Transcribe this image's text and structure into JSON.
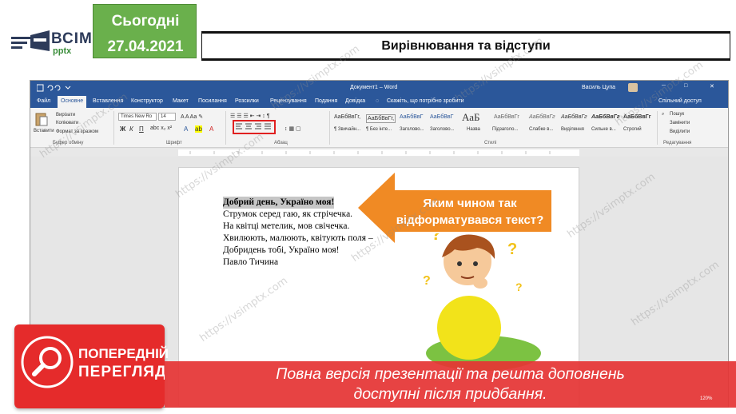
{
  "header": {
    "logo_text": "ВСІМ",
    "logo_sub": "pptx",
    "date_line1": "Сьогодні",
    "date_line2": "27.04.2021",
    "slide_title": "Вирівнювання та відступи"
  },
  "word": {
    "doc_title": "Документ1 – Word",
    "user": "Василь Цупа",
    "tabs": [
      "Файл",
      "Основне",
      "Вставлення",
      "Конструктор",
      "Макет",
      "Посилання",
      "Розсилки",
      "Рецензування",
      "Подання",
      "Довідка"
    ],
    "active_tab": "Основне",
    "tell_me": "Скажіть, що потрібно зробити",
    "share": "Спільний доступ",
    "ribbon": {
      "paste": "Вставити",
      "cut": "Вирізати",
      "copy": "Копіювати",
      "format_painter": "Формат за зразком",
      "font_name": "Times New Ro",
      "font_size": "14",
      "group_clipboard": "Буфер обміну",
      "group_font": "Шрифт",
      "group_paragraph": "Абзац",
      "group_styles": "Стилі",
      "group_editing": "Редагування",
      "find": "Пошук",
      "replace": "Замінити",
      "select": "Виділити",
      "styles": [
        {
          "preview": "АаБбВвГг,",
          "name": "¶ Звичайн..."
        },
        {
          "preview": "АаБбВвГг,",
          "name": "¶ Без інте..."
        },
        {
          "preview": "АаБбВвГ",
          "name": "Заголово..."
        },
        {
          "preview": "АаБбВвГ",
          "name": "Заголово..."
        },
        {
          "preview": "АаБ",
          "name": "Назва"
        },
        {
          "preview": "АаБ",
          "name": "Назва"
        },
        {
          "preview": "АаБбВвГг",
          "name": "Підзаголо..."
        },
        {
          "preview": "АаБбВвГг",
          "name": "Слабке в..."
        },
        {
          "preview": "АаБбВвГг",
          "name": "Виділення"
        },
        {
          "preview": "АаБбВвГг",
          "name": "Сильне в..."
        },
        {
          "preview": "АаБбВвГг",
          "name": "Строгий"
        }
      ]
    },
    "poem": [
      "Добрий день, Україно моя!",
      "Струмок серед гаю, як стрічечка.",
      "На квітці метелик, мов свічечка.",
      "Хвилюють, малюють, квітують поля –",
      "Добридень тобі, Україно моя!",
      "Павло Тичина"
    ],
    "zoom": "120%"
  },
  "callout": {
    "line1": "Яким чином так",
    "line2": "відформатувався текст?"
  },
  "preview": {
    "line1": "ПОПЕРЕДНІЙ",
    "line2": "ПЕРЕГЛЯД"
  },
  "banner": {
    "line1": "Повна версія презентації та решта доповнень",
    "line2": "доступні після придбання."
  },
  "watermark": "https://vsimptx.com",
  "colors": {
    "date_green": "#6ab04c",
    "word_blue": "#2b579a",
    "callout_orange": "#f08a24",
    "banner_red": "#e52b2b"
  }
}
